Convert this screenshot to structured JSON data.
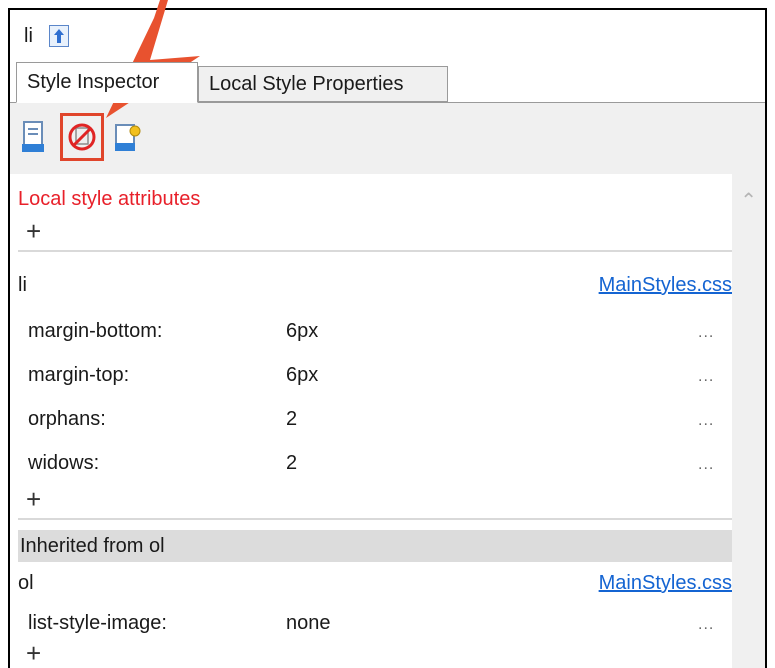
{
  "header": {
    "element": "li",
    "up_icon": "up-arrow-icon"
  },
  "tabs": [
    {
      "label": "Style Inspector",
      "active": true
    },
    {
      "label": "Local Style Properties",
      "active": false
    }
  ],
  "toolbar": {
    "buttons": [
      "new-style-icon",
      "clear-local-formatting-icon",
      "edit-style-icon"
    ],
    "highlight_color": "#e0452b"
  },
  "local_section": {
    "title": "Local style attributes",
    "add_label": "+"
  },
  "rules": [
    {
      "selector": "li",
      "file": "MainStyles.css",
      "properties": [
        {
          "name": "margin-bottom:",
          "value": "6px",
          "more": "..."
        },
        {
          "name": "margin-top:",
          "value": "6px",
          "more": "..."
        },
        {
          "name": "orphans:",
          "value": "2",
          "more": "..."
        },
        {
          "name": "widows:",
          "value": "2",
          "more": "..."
        }
      ],
      "add_label": "+"
    }
  ],
  "inherited": {
    "label": "Inherited from ol",
    "selector": "ol",
    "file": "MainStyles.css",
    "properties": [
      {
        "name": "list-style-image:",
        "value": "none",
        "more": "..."
      }
    ],
    "add_label": "+"
  },
  "colors": {
    "accent_red": "#e8202a",
    "link_blue": "#1464d2",
    "callout_orange": "#e8522f"
  }
}
